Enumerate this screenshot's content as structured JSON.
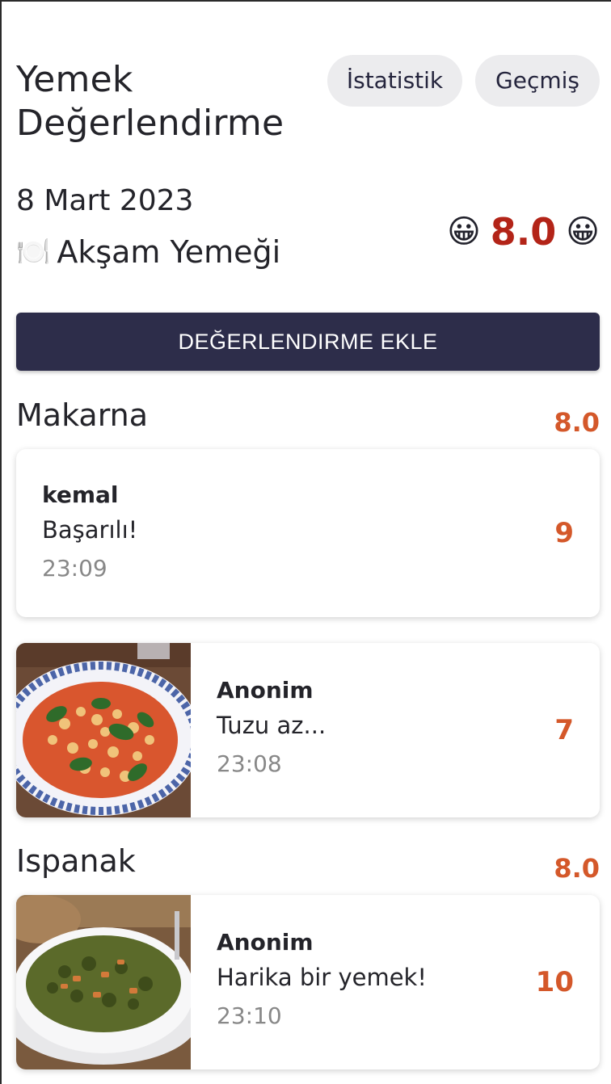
{
  "header": {
    "title": "Yemek Değerlendirme",
    "stats_label": "İstatistik",
    "history_label": "Geçmiş"
  },
  "meal": {
    "date": "8 Mart 2023",
    "icon": "🍽️",
    "name": "Akşam Yemeği",
    "emoji_left": "😀",
    "score": "8.0",
    "emoji_right": "😀"
  },
  "actions": {
    "add_review_label": "DEĞERLENDIRME EKLE"
  },
  "sections": [
    {
      "name": "Makarna",
      "score": "8.0",
      "reviews": [
        {
          "user": "kemal",
          "comment": "Başarılı!",
          "time": "23:09",
          "rating": "9",
          "has_photo": false
        },
        {
          "user": "Anonim",
          "comment": "Tuzu az...",
          "time": "23:08",
          "rating": "7",
          "has_photo": true,
          "photo": "pasta-with-spinach-photo"
        }
      ]
    },
    {
      "name": "Ispanak",
      "score": "8.0",
      "reviews": [
        {
          "user": "Anonim",
          "comment": "Harika bir yemek!",
          "time": "23:10",
          "rating": "10",
          "has_photo": true,
          "photo": "spinach-stew-photo"
        }
      ]
    }
  ],
  "colors": {
    "accent": "#d4582a",
    "overall_score": "#b32418",
    "button": "#2d2d4a"
  }
}
